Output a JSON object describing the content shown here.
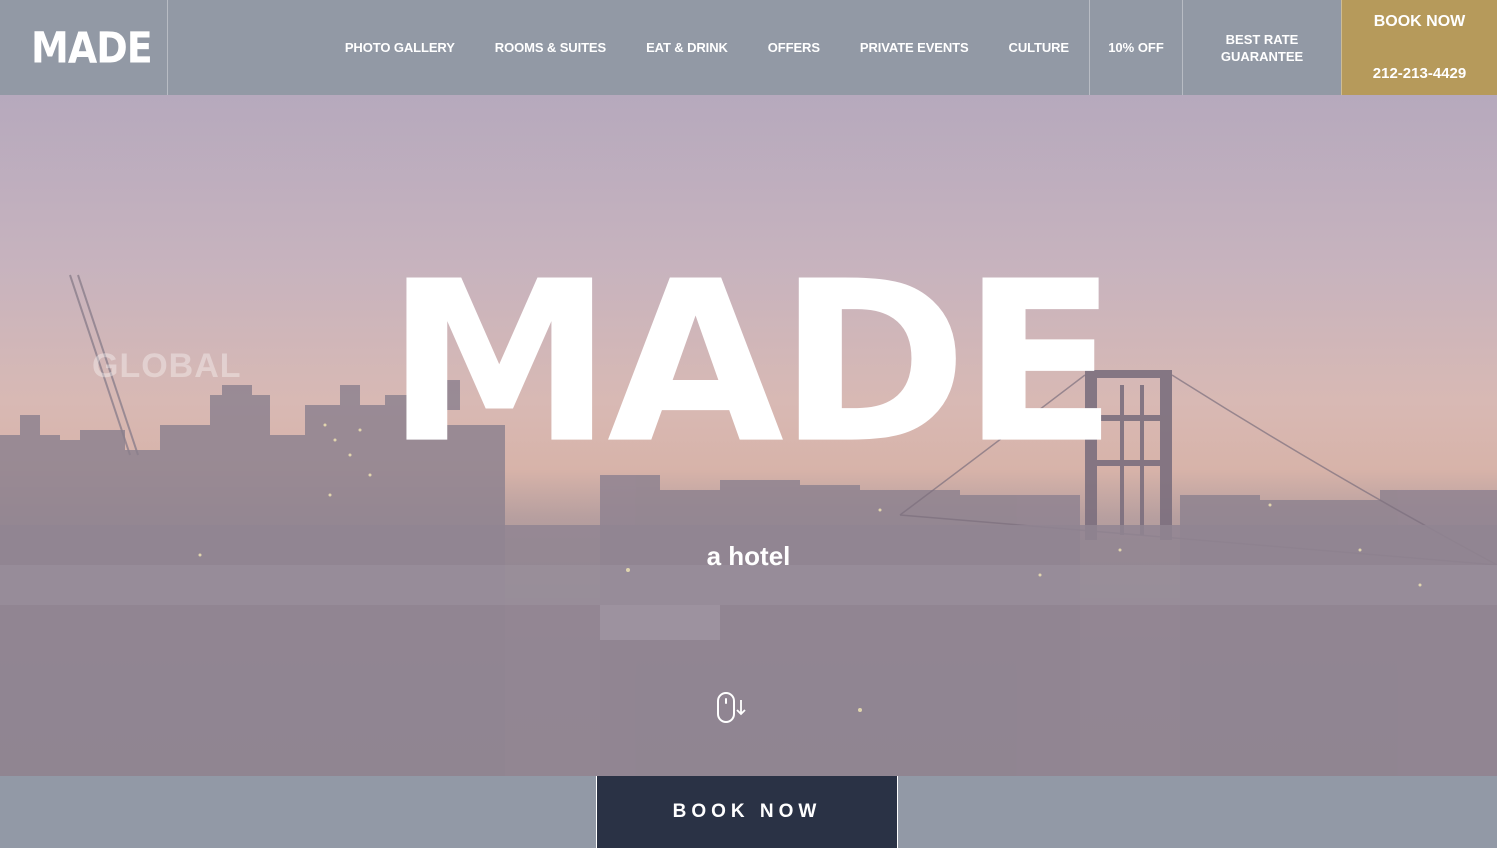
{
  "header": {
    "logo": "MADE",
    "nav": [
      {
        "label": "PHOTO GALLERY"
      },
      {
        "label": "ROOMS & SUITES"
      },
      {
        "label": "EAT & DRINK"
      },
      {
        "label": "OFFERS"
      },
      {
        "label": "PRIVATE EVENTS"
      },
      {
        "label": "CULTURE"
      }
    ],
    "offer": "10% OFF",
    "best_rate_line1": "BEST RATE",
    "best_rate_line2": "GUARANTEE",
    "book_now": "BOOK NOW",
    "phone": "212-213-4429"
  },
  "hero": {
    "title": "MADE",
    "subtitle": "a hotel",
    "background_sign": "GLOBAL",
    "scroll_icon": "mouse-scroll-icon"
  },
  "footer_bar": {
    "book_button": "BOOK NOW"
  },
  "colors": {
    "header_bg": "#9299a5",
    "book_accent": "#b69a5b",
    "book_button_bg": "#2a3245"
  }
}
